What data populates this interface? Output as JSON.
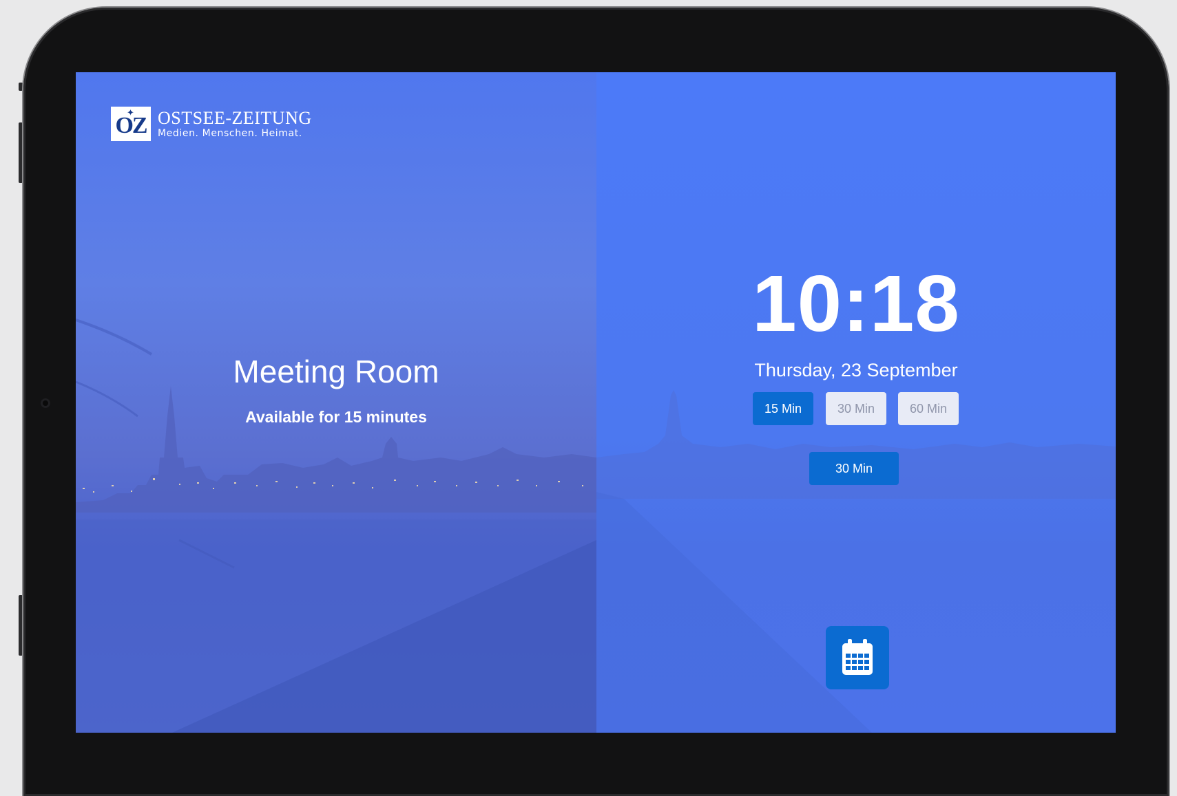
{
  "logo": {
    "mark": "OZ",
    "name": "OSTSEE-ZEITUNG",
    "tagline": "Medien. Menschen. Heimat."
  },
  "room": {
    "title": "Meeting Room",
    "availability": "Available for 15 minutes"
  },
  "clock": {
    "time": "10:18",
    "date": "Thursday, 23 September"
  },
  "duration_options": [
    {
      "label": "15 Min",
      "selected": true
    },
    {
      "label": "30 Min",
      "selected": false
    },
    {
      "label": "60 Min",
      "selected": false
    }
  ],
  "book_button": {
    "label": "30 Min"
  },
  "calendar_button": {
    "icon": "calendar-icon"
  },
  "colors": {
    "screen_blue": "#4c7af8",
    "button_blue": "#0b6bd1",
    "button_light": "#e8ebf6",
    "frame": "#121213"
  }
}
